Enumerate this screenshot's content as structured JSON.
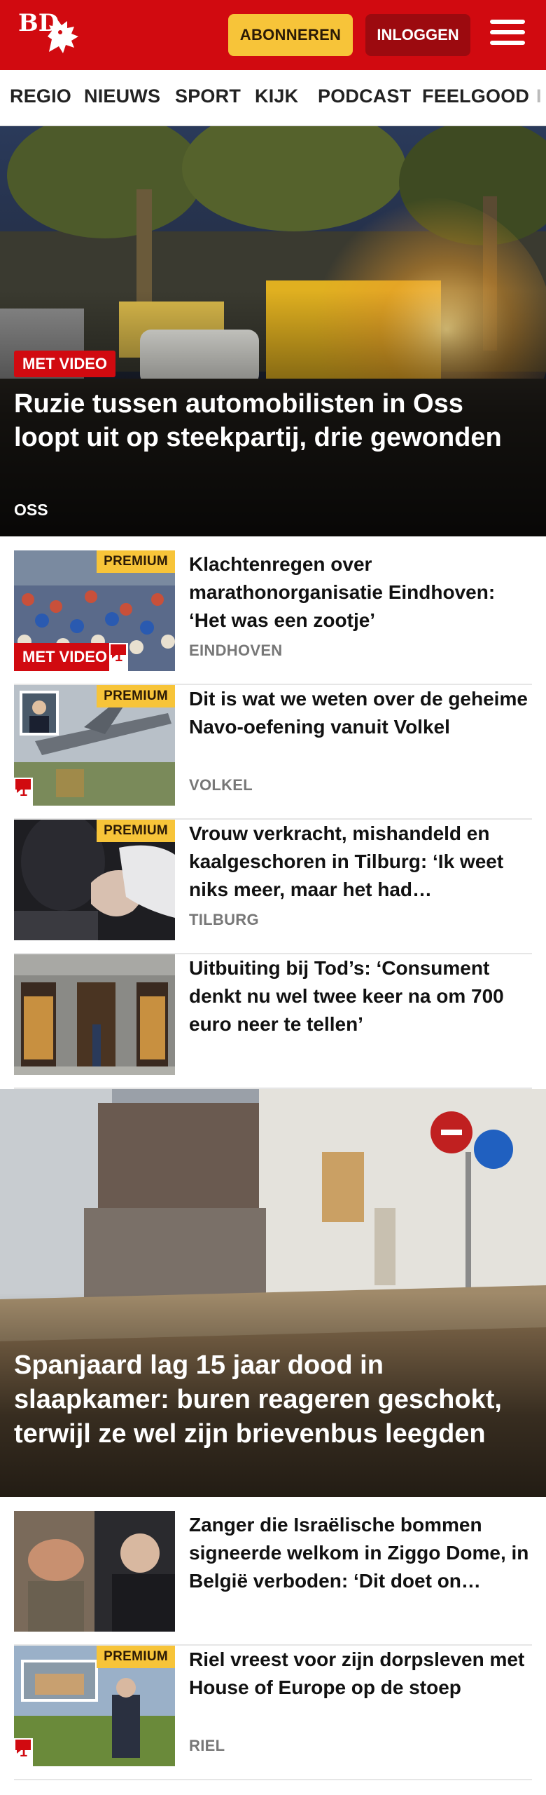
{
  "header": {
    "logo_text": "BD",
    "subscribe_label": "ABONNEREN",
    "login_label": "INLOGGEN",
    "colors": {
      "brand_red": "#d10a10",
      "subscribe_yellow": "#f7c439",
      "login_dark_red": "#9c0a0f"
    }
  },
  "nav": {
    "items": [
      "REGIO",
      "NIEUWS",
      "SPORT",
      "KIJK",
      "PODCAST",
      "FEELGOOD",
      "I"
    ]
  },
  "hero": {
    "badge": "MET VIDEO",
    "title": "Ruzie tussen automobilisten in Oss loopt uit op steekpartij, drie gewonden",
    "location": "OSS"
  },
  "articles": [
    {
      "title": "Klachtenregen over marathonorganisatie Eindhoven: ‘Het was een zootje’",
      "location": "EINDHOVEN",
      "premium": "PREMIUM",
      "video_badge": "MET VIDEO",
      "comments": "1"
    },
    {
      "title": "Dit is wat we weten over de geheime Navo-oefening vanuit Volkel",
      "location": "VOLKEL",
      "premium": "PREMIUM",
      "comments": "1"
    },
    {
      "title": "Vrouw verkracht, mishandeld en kaalgeschoren in Tilburg: ‘Ik weet niks meer, maar het had…",
      "location": "TILBURG",
      "premium": "PREMIUM"
    },
    {
      "title": "Uitbuiting bij Tod’s: ‘Consument denkt nu wel twee keer na om 700 euro neer te tellen’"
    }
  ],
  "feature": {
    "title": "Spanjaard lag 15 jaar dood in slaapkamer: buren reageren geschokt, terwijl ze wel zijn brievenbus leegden"
  },
  "articles_2": [
    {
      "title": "Zanger die Israëlische bommen signeerde welkom in Ziggo Dome, in België verboden: ‘Dit doet on…"
    },
    {
      "title": "Riel vreest voor zijn dorpsleven met House of Europe op de stoep",
      "location": "RIEL",
      "premium": "PREMIUM",
      "comments": "1"
    }
  ],
  "icons": [
    "lion-logo-icon",
    "hamburger-menu-icon",
    "comment-icon"
  ]
}
